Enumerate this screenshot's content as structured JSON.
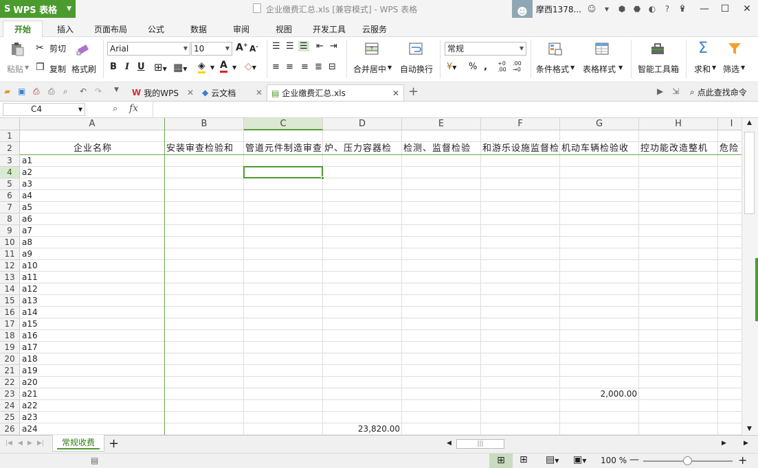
{
  "app": {
    "menu_label": "WPS 表格",
    "window_title": "企业缴费汇总.xls [兼容模式] - WPS 表格",
    "username": "摩西1378..."
  },
  "menu": {
    "items": [
      "开始",
      "插入",
      "页面布局",
      "公式",
      "数据",
      "审阅",
      "视图",
      "开发工具",
      "云服务"
    ],
    "active": 0
  },
  "ribbon": {
    "paste": "粘贴",
    "cut": "剪切",
    "copy": "复制",
    "format_painter": "格式刷",
    "font_name": "Arial",
    "font_size": "10",
    "merge_center": "合并居中",
    "wrap_text": "自动换行",
    "number_format": "常规",
    "conditional_format": "条件格式",
    "table_style": "表格样式",
    "smart_toolbox": "智能工具箱",
    "sum": "求和",
    "filter": "筛选"
  },
  "doc_tabs": [
    {
      "label": "我的WPS"
    },
    {
      "label": "云文档"
    },
    {
      "label": "企业缴费汇总.xls"
    }
  ],
  "search_command": "点此查找命令",
  "formula_bar": {
    "cell_ref": "C4",
    "fx": "fx",
    "value": ""
  },
  "grid": {
    "columns": [
      "A",
      "B",
      "C",
      "D",
      "E",
      "F",
      "G",
      "H",
      "I"
    ],
    "selected_column": "C",
    "selected_row": 4,
    "rows": [
      "1",
      "2",
      "3",
      "4",
      "5",
      "6",
      "7",
      "8",
      "9",
      "10",
      "11",
      "12",
      "13",
      "14",
      "15",
      "16",
      "17",
      "18",
      "19",
      "20",
      "21",
      "22",
      "23",
      "24",
      "25",
      "26"
    ],
    "header_row": [
      "企业名称",
      "安装审查检验和",
      "管道元件制造审查",
      "炉、压力容器检",
      "检测、监督检验",
      "和游乐设施监督检",
      "机动车辆检验收",
      "控功能改造整机",
      "危险"
    ],
    "companies": [
      "a1",
      "a2",
      "a3",
      "a4",
      "a5",
      "a6",
      "a7",
      "a8",
      "a9",
      "a10",
      "a11",
      "a12",
      "a13",
      "a14",
      "a15",
      "a16",
      "a17",
      "a18",
      "a19",
      "a20",
      "a21",
      "a22",
      "a23",
      "a24"
    ],
    "value_g23": "2,000.00",
    "value_d26": "23,820.00"
  },
  "sheet_tabs": [
    "常规收费"
  ],
  "status": {
    "zoom": "100 %"
  }
}
